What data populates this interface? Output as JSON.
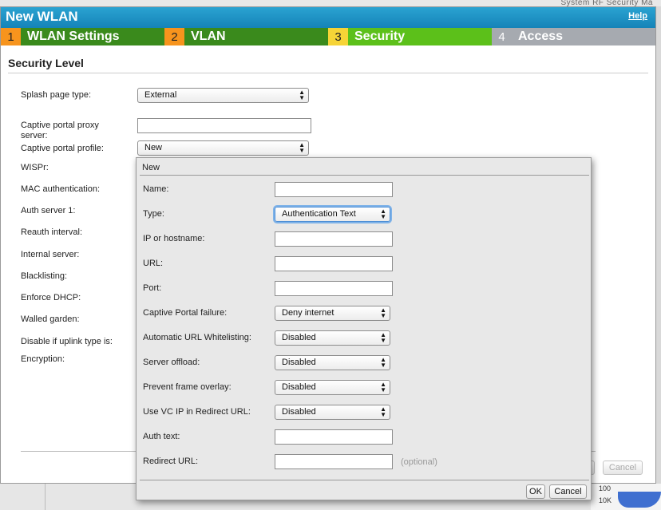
{
  "background": {
    "nav_text": "System   RF   Security   Ma",
    "chart_labels": [
      "100",
      "10K"
    ]
  },
  "wizard": {
    "title": "New WLAN",
    "help_label": "Help",
    "steps": [
      {
        "num": "1",
        "label": "WLAN Settings"
      },
      {
        "num": "2",
        "label": "VLAN"
      },
      {
        "num": "3",
        "label": "Security"
      },
      {
        "num": "4",
        "label": "Access"
      }
    ],
    "section_title": "Security Level",
    "fields": {
      "splash_page_type": {
        "label": "Splash page type:",
        "value": "External"
      },
      "proxy_server": {
        "label_line1": "Captive portal proxy",
        "label_line2": "server:",
        "value": ""
      },
      "portal_profile": {
        "label": "Captive portal profile:",
        "value": "New"
      },
      "wispr": {
        "label": "WISPr:"
      },
      "mac_auth": {
        "label": "MAC authentication:"
      },
      "auth_server_1": {
        "label": "Auth server 1:"
      },
      "reauth_interval": {
        "label": "Reauth interval:"
      },
      "internal_server": {
        "label": "Internal server:"
      },
      "blacklisting": {
        "label": "Blacklisting:"
      },
      "enforce_dhcp": {
        "label": "Enforce DHCP:"
      },
      "walled_garden": {
        "label": "Walled garden:"
      },
      "disable_uplink": {
        "label": "Disable if uplink type is:"
      },
      "encryption": {
        "label": "Encryption:"
      }
    },
    "cancel_label": "Cancel"
  },
  "popup": {
    "title": "New",
    "name": {
      "label": "Name:",
      "value": ""
    },
    "type": {
      "label": "Type:",
      "value": "Authentication Text"
    },
    "ip_hostname": {
      "label": "IP or hostname:",
      "value": ""
    },
    "url": {
      "label": "URL:",
      "value": ""
    },
    "port": {
      "label": "Port:",
      "value": ""
    },
    "captive_failure": {
      "label": "Captive Portal failure:",
      "value": "Deny internet"
    },
    "auto_url_whitelist": {
      "label": "Automatic URL Whitelisting:",
      "value": "Disabled"
    },
    "server_offload": {
      "label": "Server offload:",
      "value": "Disabled"
    },
    "prevent_frame_overlay": {
      "label": "Prevent frame overlay:",
      "value": "Disabled"
    },
    "use_vc_ip": {
      "label": "Use VC IP in Redirect URL:",
      "value": "Disabled"
    },
    "auth_text": {
      "label": "Auth text:",
      "value": ""
    },
    "redirect_url": {
      "label": "Redirect URL:",
      "value": "",
      "hint": "(optional)"
    },
    "ok_label": "OK",
    "cancel_label": "Cancel"
  },
  "colors": {
    "title_bar": "#1a8fc4",
    "step_done": "#3a8a1c",
    "step_active": "#5cc01a",
    "step_inactive": "#a6aab0",
    "step_num_orange": "#f7941d",
    "step_num_yellow": "#f6d437"
  }
}
